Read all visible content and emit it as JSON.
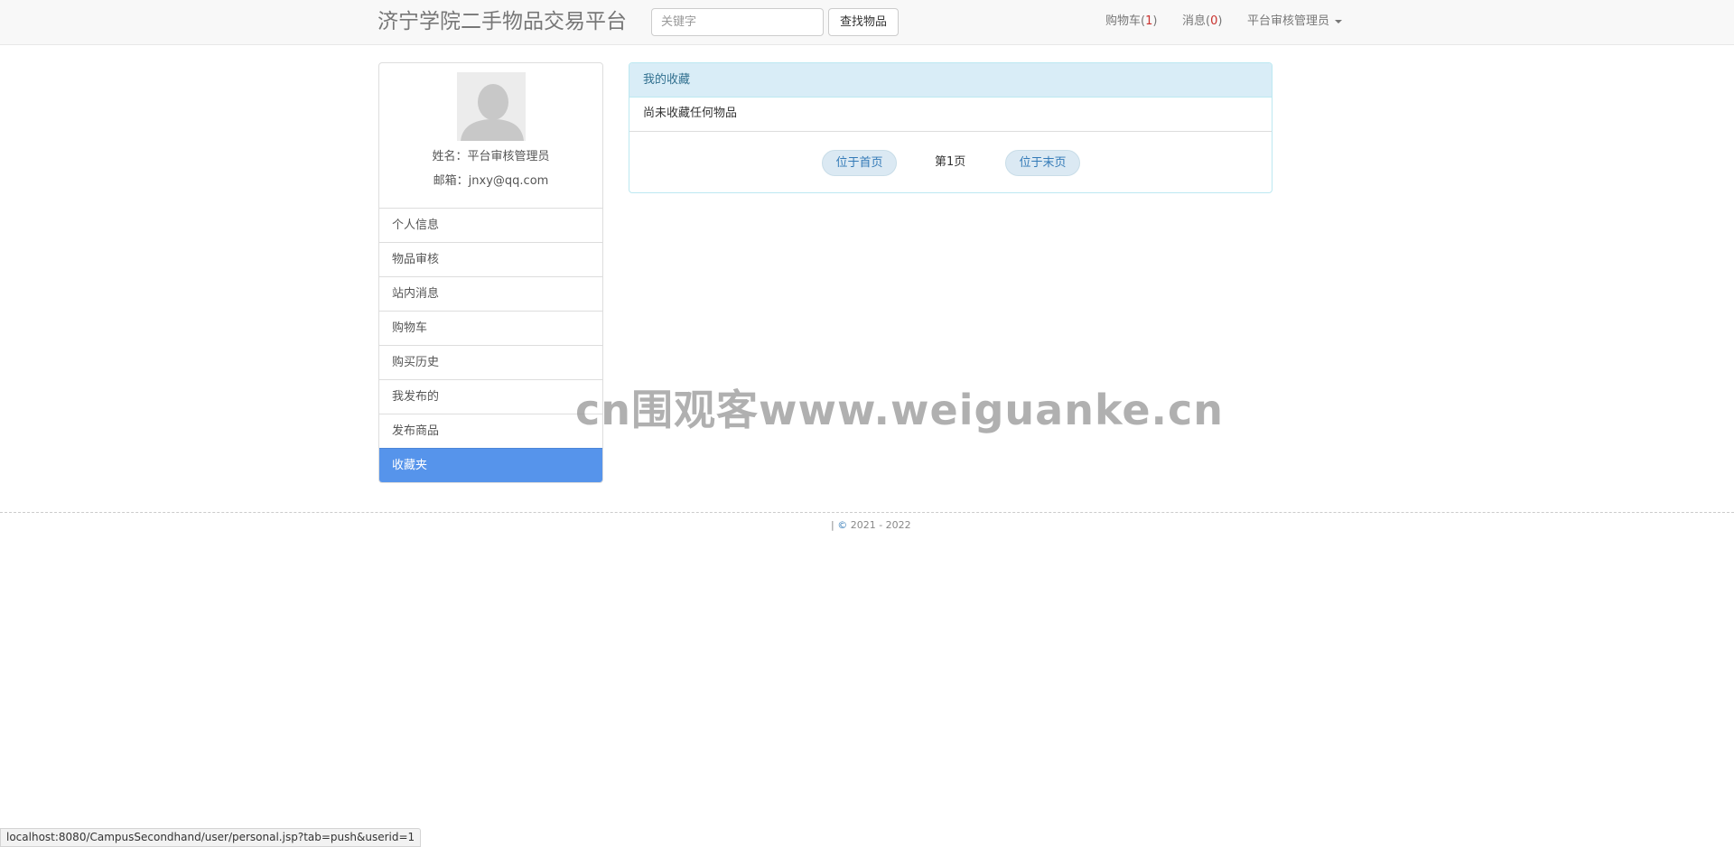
{
  "navbar": {
    "brand": "济宁学院二手物品交易平台",
    "search_placeholder": "关键字",
    "search_button": "查找物品",
    "cart_label": "购物车",
    "cart_count": "1",
    "messages_label": "消息",
    "messages_count": "0",
    "user_menu_label": "平台审核管理员"
  },
  "profile": {
    "name_line": "姓名：平台审核管理员",
    "email_line": "邮箱：jnxy@qq.com"
  },
  "sidebar": {
    "items": [
      {
        "label": "个人信息"
      },
      {
        "label": "物品审核"
      },
      {
        "label": "站内消息"
      },
      {
        "label": "购物车"
      },
      {
        "label": "购买历史"
      },
      {
        "label": "我发布的"
      },
      {
        "label": "发布商品"
      },
      {
        "label": "收藏夹"
      }
    ],
    "active_index": 7
  },
  "favorites": {
    "heading": "我的收藏",
    "empty_message": "尚未收藏任何物品",
    "first_page_button": "位于首页",
    "page_prefix": "第",
    "page_number": "1",
    "page_suffix": "页",
    "last_page_button": "位于末页"
  },
  "watermark": "cn围观客www.weiguanke.cn",
  "footer": {
    "separator": "|",
    "copyright_symbol": "©",
    "years": "2021 - 2022"
  },
  "statusbar": {
    "url": "localhost:8080/CampusSecondhand/user/personal.jsp?tab=push&userid=1"
  },
  "colors": {
    "active_item": "#5694eb",
    "panel_heading_bg": "#d9edf7",
    "count_red": "#c9302c",
    "link_blue": "#337ab7"
  }
}
